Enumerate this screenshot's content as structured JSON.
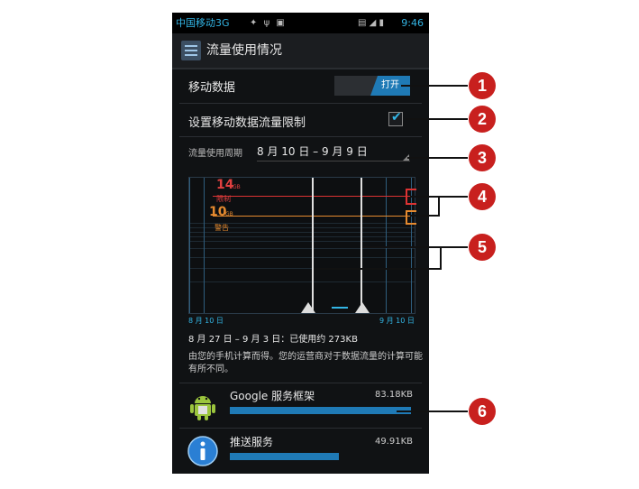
{
  "status_bar": {
    "carrier": "中国移动3G",
    "time": "9:46",
    "icons": [
      "android-icon",
      "usb-icon",
      "image-icon",
      "sd-icon",
      "signal-icon",
      "battery-icon"
    ]
  },
  "action_bar": {
    "title": "流量使用情况",
    "icon": "data-usage-icon"
  },
  "mobile_data": {
    "label": "移动数据",
    "toggle_state": "打开"
  },
  "limit_setting": {
    "label": "设置移动数据流量限制",
    "checked": true
  },
  "cycle": {
    "label": "流量使用周期",
    "value": "8 月 10 日 – 9 月 9 日"
  },
  "chart": {
    "limit_value": "14",
    "limit_unit": "GB",
    "limit_label": "限制",
    "warning_value": "10",
    "warning_unit": "GB",
    "warning_label": "警告",
    "x_start": "8 月 10 日",
    "x_end": "9 月 10 日"
  },
  "range_summary": "8 月 27 日 – 9 月 3 日：已使用约 273KB",
  "note": "由您的手机计算而得。您的运营商对于数据流量的计算可能有所不同。",
  "apps": [
    {
      "name": "Google 服务框架",
      "size": "83.18KB",
      "share": 1.0,
      "icon": "android-icon"
    },
    {
      "name": "推送服务",
      "size": "49.91KB",
      "share": 0.6,
      "icon": "info-icon"
    }
  ],
  "callouts": [
    "1",
    "2",
    "3",
    "4",
    "5",
    "6"
  ],
  "colors": {
    "accent": "#33b5e5",
    "limit": "#d33333",
    "warning": "#e58a2f",
    "badge": "#c8201e"
  }
}
